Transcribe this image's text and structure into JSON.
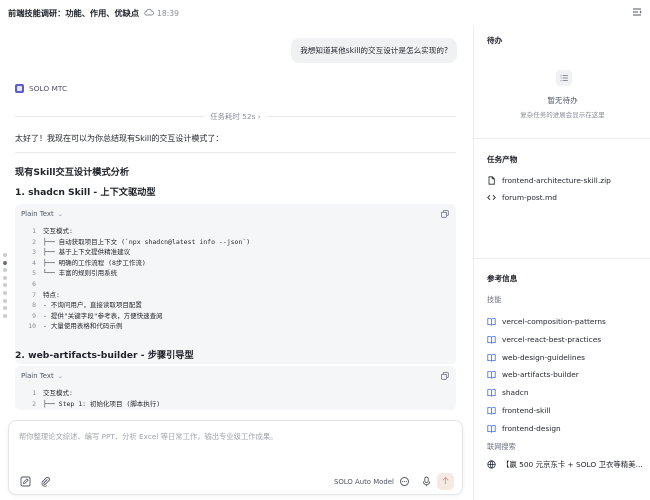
{
  "header": {
    "title": "前端技能调研：功能、作用、优缺点",
    "time": "18:39"
  },
  "chat": {
    "user_message": "我想知道其他skill的交互设计是怎么实现的?",
    "agent_name": "SOLO MTC",
    "task_time": "任务耗时 52s",
    "intro": "太好了！我现在可以为你总结现有Skill的交互设计模式了：",
    "heading": "现有Skill交互设计模式分析",
    "section1_title": "1. shadcn Skill - 上下文驱动型",
    "code1": {
      "lang": "Plain Text",
      "lines": [
        {
          "n": "1",
          "t": "交互模式:"
        },
        {
          "n": "2",
          "t": "├── 自动获取项目上下文 (`npx shadcn@latest info --json`)"
        },
        {
          "n": "3",
          "t": "├── 基于上下文提供精准建议"
        },
        {
          "n": "4",
          "t": "├── 明确的工作流程 (8步工作流)"
        },
        {
          "n": "5",
          "t": "└── 丰富的规则引用系统"
        },
        {
          "n": "6",
          "t": ""
        },
        {
          "n": "7",
          "t": "特点:"
        },
        {
          "n": "8",
          "t": "- 不询问用户，直接读取项目配置"
        },
        {
          "n": "9",
          "t": "- 提供\"关键字段\"参考表，方便快速查阅"
        },
        {
          "n": "10",
          "t": "- 大量使用表格和代码示例"
        }
      ]
    },
    "section2_title": "2. web-artifacts-builder - 步骤引导型",
    "code2": {
      "lang": "Plain Text",
      "lines": [
        {
          "n": "1",
          "t": "交互模式:"
        },
        {
          "n": "2",
          "t": "├── Step 1: 初始化项目 (脚本执行)"
        }
      ]
    }
  },
  "composer": {
    "placeholder": "帮你整理论文综述、编写 PPT、分析 Excel 等日常工作，输出专业级工作成果。",
    "model": "SOLO Auto Model"
  },
  "side": {
    "todo_title": "待办",
    "todo_empty_title": "暂无待办",
    "todo_empty_sub": "复杂任务的进展会显示在这里",
    "outputs_title": "任务产物",
    "outputs": [
      {
        "name": "frontend-architecture-skill.zip",
        "icon": "file-icon"
      },
      {
        "name": "forum-post.md",
        "icon": "code-icon"
      }
    ],
    "refs_title": "参考信息",
    "skills_label": "技能",
    "skills": [
      "vercel-composition-patterns",
      "vercel-react-best-practices",
      "web-design-guidelines",
      "web-artifacts-builder",
      "shadcn",
      "frontend-skill",
      "frontend-design"
    ],
    "web_label": "联网搜索",
    "web_result": "【赢 500 元京东卡 + SOLO 卫衣等精美…"
  },
  "colors": {
    "accent": "#3c6fd9",
    "agent_avatar": "#5b5fc7",
    "send_bg": "#f5e9e4"
  }
}
